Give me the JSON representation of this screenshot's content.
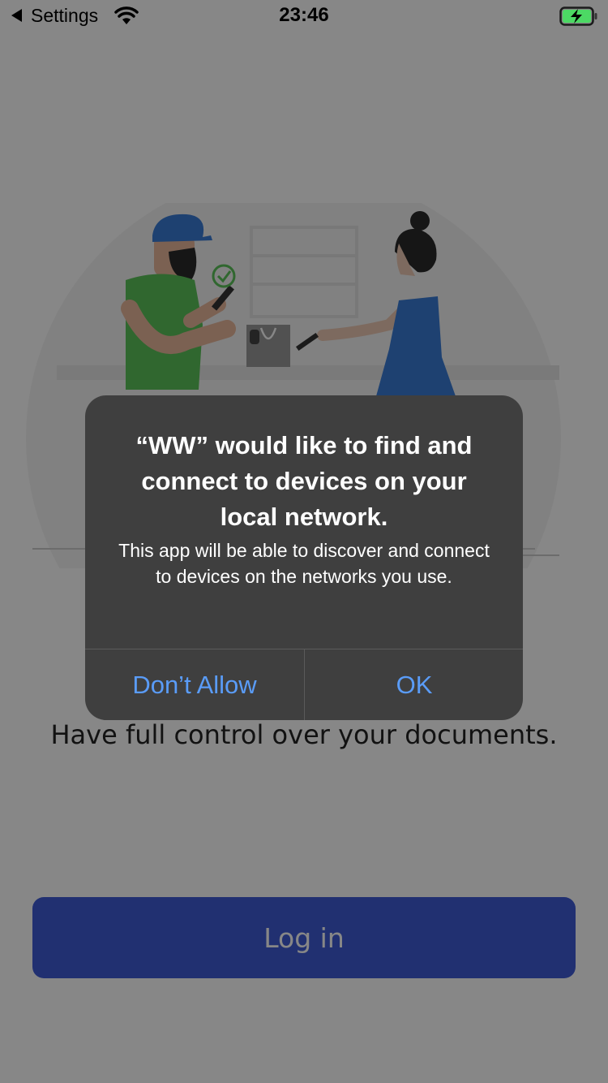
{
  "status_bar": {
    "back_app": "Settings",
    "time": "23:46",
    "icons": [
      "back-arrow-icon",
      "wifi-icon",
      "battery-charging-icon"
    ]
  },
  "main": {
    "tagline": "Have full control over your documents.",
    "login_label": "Log in"
  },
  "alert": {
    "title": "“WW” would like to find and connect to devices on your local network.",
    "message": "This app will be able to discover and connect to devices on the networks you use.",
    "deny_label": "Don’t Allow",
    "ok_label": "OK"
  },
  "colors": {
    "button_blue": "#3f5bd6",
    "alert_link": "#5a9cf8",
    "battery_green": "#4cd964"
  }
}
